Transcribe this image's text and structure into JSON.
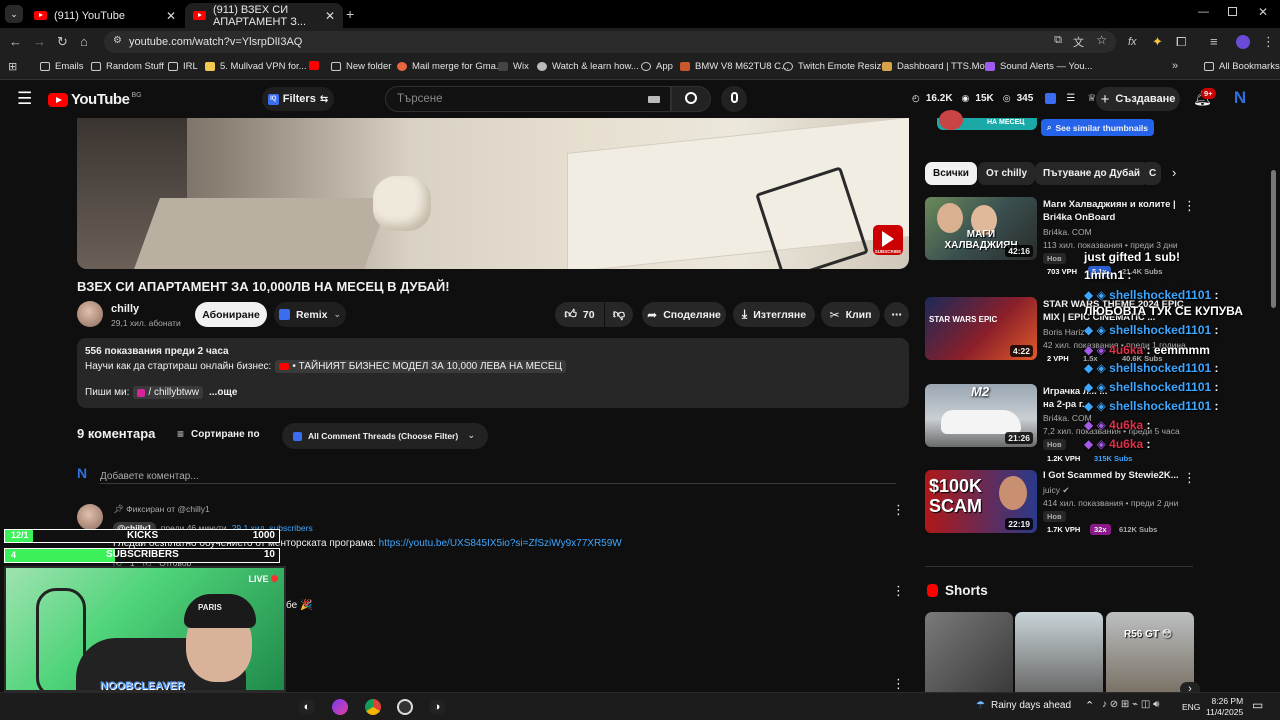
{
  "browser": {
    "tabs": [
      {
        "title": "(911) YouTube"
      },
      {
        "title": "(911) ВЗЕХ СИ АПАРТАМЕНТ З..."
      }
    ],
    "url": "youtube.com/watch?v=YlsrpDlI3AQ",
    "bookmarks": [
      "Emails",
      "Random Stuff",
      "IRL",
      "5. Mullvad VPN for...",
      "New folder",
      "Mail merge for Gma...",
      "Wix",
      "Watch & learn how...",
      "App",
      "BMW V8 M62TU8 C...",
      "Twitch Emote Resizer",
      "Dashboard | TTS.Mo...",
      "Sound Alerts — You...",
      "All Bookmarks"
    ]
  },
  "yt_header": {
    "logo_text": "YouTube",
    "logo_region": "BG",
    "filters_label": "Filters",
    "search_placeholder": "Търсене",
    "stats": {
      "views": "16.2K",
      "likes": "15K",
      "viewers": "345"
    },
    "create_label": "Създаване",
    "notif_count": "9+"
  },
  "video": {
    "title": "ВЗЕХ СИ АПАРТАМЕНТ ЗА 10,000ЛВ НА МЕСЕЦ В ДУБАЙ!",
    "subscribe_badge": "SUBSCRIBE",
    "channel": "chilly",
    "subs": "29,1 хил. абонати",
    "subscribe_label": "Абониране",
    "remix_label": "Remix",
    "likes": "70",
    "share_label": "Споделяне",
    "download_label": "Изтегляне",
    "clip_label": "Клип"
  },
  "description": {
    "meta": "556 показвания  преди 2 часа",
    "line1_prefix": "Научи как да стартираш онлайн бизнес:",
    "line1_link": "• ТАЙНИЯТ БИЗНЕС МОДЕЛ ЗА 10,000 ЛЕВА НА МЕСЕЦ",
    "line2_prefix": "Пиши ми:",
    "line2_link": "/ chillybtww",
    "more": "...още"
  },
  "comments": {
    "count_label": "9 коментара",
    "sort_label": "Сортиране по",
    "filter_label": "All Comment Threads (Choose Filter)",
    "add_placeholder": "Добавете коментар...",
    "pinned_label": "Фиксиран от @chilly1",
    "author": "@chilly1",
    "time": "преди 46 минути",
    "author_subs": "29.1 хил. subscribers",
    "text_prefix": "Гледай безплатно обучението от менторската програма:",
    "text_link": "https://youtu.be/UXS845IX5io?si=ZfSziWy9x77XR59W",
    "reply": "Отговор",
    "likes": "1",
    "second_comment_tail": "бе 🎉"
  },
  "sidebar": {
    "see_similar": "See similar thumbnails",
    "thumb_caption": "НА МЕСЕЦ",
    "chips": [
      "Всички",
      "От chilly",
      "Пътуване до Дубай",
      "С"
    ],
    "videos": [
      {
        "title1": "Маги Халваджиян и колите |",
        "title2": "Bri4ka OnBoard",
        "channel": "Bri4ka. COM",
        "meta": "113 хил. показвания • преди 3 дни",
        "duration": "42:16",
        "new": "Нов",
        "vph": "703 VPH",
        "badge": "5.1x",
        "subs": "21.4K Subs",
        "thumb_text": "МАГИ ХАЛВАДЖИЯН"
      },
      {
        "title1": "STAR WARS THEME 2024 EPIC",
        "title2": "MIX | EPIC CINEMATIC ...",
        "channel": "Boris Hariz",
        "meta": "42 хил. показвания • преди 1 година",
        "duration": "4:22",
        "new": "",
        "vph": "2 VPH",
        "badge": "1.5x",
        "subs": "40.6K Subs",
        "thumb_text": "STAR WARS EPIC"
      },
      {
        "title1": "Играчка л... ...",
        "title2": "на 2-ра г...",
        "channel": "Bri4ka. COM",
        "meta": "7,2 хил. показвания • преди 5 часа",
        "duration": "21:26",
        "new": "Нов",
        "vph": "1.2K VPH",
        "badge": "",
        "subs": "315K Subs",
        "thumb_text": "M2"
      },
      {
        "title1": "I Got Scammed by Stewie2K...",
        "title2": "",
        "channel": "juicy",
        "meta": "414 хил. показвания • преди 2 дни",
        "duration": "22:19",
        "new": "Нов",
        "vph": "1.7K VPH",
        "badge": "32x",
        "subs": "612K Subs",
        "thumb_text": "$100K SCAM"
      }
    ],
    "shorts_label": "Shorts",
    "short_caption": "R56 GT 😳"
  },
  "chat_overlay": [
    {
      "user": "",
      "msg": "just gifted 1 sub!"
    },
    {
      "user": "1mrtn1",
      "msg": ""
    },
    {
      "user": "shellshocked1101",
      "msg": ""
    },
    {
      "user": "",
      "msg": "ЛЮБОВТА ТУК СЕ КУПУВА"
    },
    {
      "user": "shellshocked1101",
      "msg": ""
    },
    {
      "user": "4u6ka",
      "msg": "eemmmm"
    },
    {
      "user": "shellshocked1101",
      "msg": ""
    },
    {
      "user": "shellshocked1101",
      "msg": ""
    },
    {
      "user": "shellshocked1101",
      "msg": ""
    },
    {
      "user": "4u6ka",
      "msg": ""
    },
    {
      "user": "4u6ka",
      "msg": ""
    }
  ],
  "stream_overlay": {
    "kicks_label": "KICKS",
    "kicks_value": "1000",
    "kicks_count": "12/1",
    "subs_label": "SUBSCRIBERS",
    "subs_value": "10",
    "subs_count": "4",
    "live_label": "LIVE",
    "streamer_name": "NOOBCLEAVER",
    "cap_text": "PARIS"
  },
  "taskbar": {
    "weather": "Rainy days ahead",
    "lang": "ENG",
    "time": "8:26 PM",
    "date": "11/4/2025"
  },
  "colors": {
    "accent_blue": "#3ea6ff",
    "youtube_red": "#ff0000",
    "green_overlay": "#3cf05a"
  }
}
